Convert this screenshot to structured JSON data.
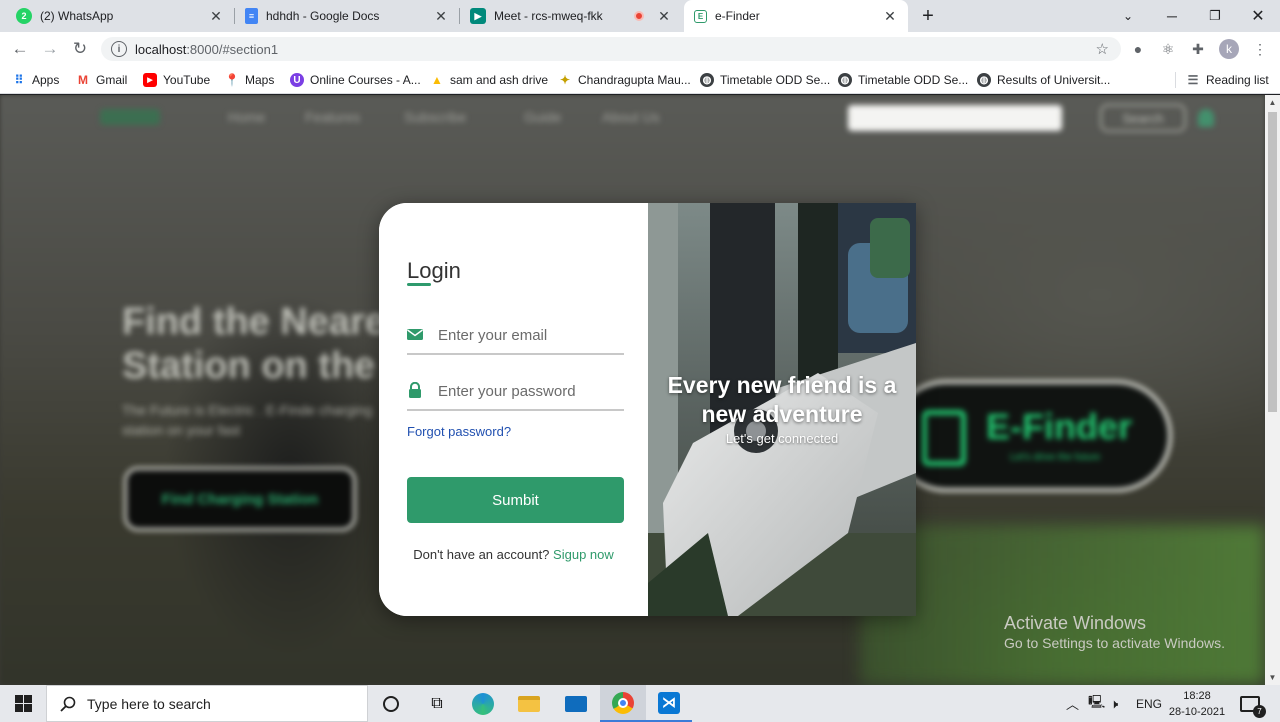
{
  "browser": {
    "tabs": [
      {
        "title": "(2) WhatsApp",
        "icon": "whatsapp-icon"
      },
      {
        "title": "hdhdh - Google Docs",
        "icon": "google-docs-icon"
      },
      {
        "title": "Meet - rcs-mweq-fkk",
        "icon": "google-meet-icon"
      },
      {
        "title": "e-Finder",
        "icon": "e-finder-icon"
      }
    ],
    "active_tab_index": 3,
    "new_tab": "+",
    "address": {
      "host": "localhost",
      "path": ":8000/#section1"
    },
    "profile_initial": "k",
    "bookmarks": [
      {
        "label": "Apps",
        "icon": "apps-grid-icon"
      },
      {
        "label": "Gmail",
        "icon": "gmail-icon"
      },
      {
        "label": "YouTube",
        "icon": "youtube-icon"
      },
      {
        "label": "Maps",
        "icon": "maps-icon"
      },
      {
        "label": "Online Courses - A...",
        "icon": "courses-icon"
      },
      {
        "label": "sam and ash drive",
        "icon": "drive-icon"
      },
      {
        "label": "Chandragupta Mau...",
        "icon": "bookmark-icon"
      },
      {
        "label": "Timetable ODD Se...",
        "icon": "globe-icon"
      },
      {
        "label": "Timetable ODD Se...",
        "icon": "globe-icon"
      },
      {
        "label": "Results of Universit...",
        "icon": "globe-icon"
      }
    ],
    "reading_list": "Reading list"
  },
  "login": {
    "title": "Login",
    "email_placeholder": "Enter your email",
    "password_placeholder": "Enter your password",
    "forgot": "Forgot password?",
    "submit": "Sumbit",
    "signup_prompt": "Don't have an account?",
    "signup_link": "Sigup now",
    "panel_heading": "Every new friend is a new adventure",
    "panel_sub": "Let's get connected",
    "accent_color": "#2f9a6b"
  },
  "background_page": {
    "nav": [
      "Home",
      "Features",
      "Subscribe",
      "Guide",
      "About Us"
    ],
    "search_button": "Search",
    "hero_title_line1": "Find the Neare",
    "hero_title_line2": "Station on the g",
    "hero_sub": "The Future is Electric . E-Finde charging station on your fast",
    "hero_button": "Find Charging Station",
    "banner_title": "E-Finder",
    "banner_sub": "Let's drive the future"
  },
  "watermark": {
    "line1": "Activate Windows",
    "line2": "Go to Settings to activate Windows."
  },
  "taskbar": {
    "search_placeholder": "Type here to search",
    "language": "ENG",
    "time": "18:28",
    "date": "28-10-2021",
    "notification_count": "7"
  }
}
